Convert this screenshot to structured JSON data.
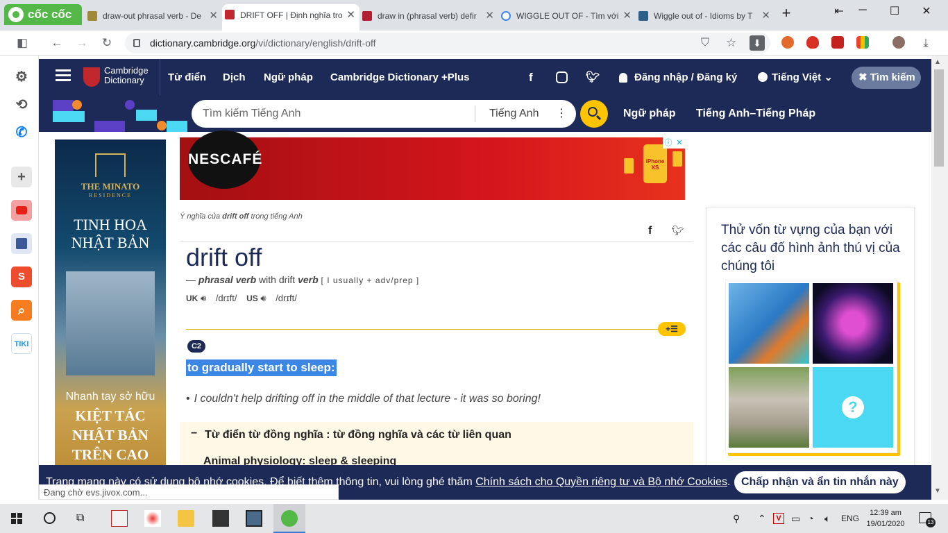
{
  "browser": {
    "brand": "cốc cốc",
    "tabs": [
      {
        "title": "draw-out phrasal verb - De",
        "active": false
      },
      {
        "title": "DRIFT OFF | Định nghĩa tro",
        "active": true
      },
      {
        "title": "draw in (phrasal verb) defir",
        "active": false
      },
      {
        "title": "WIGGLE OUT OF - Tìm với C",
        "active": false
      },
      {
        "title": "Wiggle out of - Idioms by T",
        "active": false
      }
    ],
    "url_host": "dictionary.cambridge.org",
    "url_path": "/vi/dictionary/english/drift-off"
  },
  "site": {
    "logo_line1": "Cambridge",
    "logo_line2": "Dictionary",
    "nav": [
      "Từ điển",
      "Dịch",
      "Ngữ pháp",
      "Cambridge Dictionary +Plus"
    ],
    "login": "Đăng nhập / Đăng ký",
    "language": "Tiếng Việt",
    "search_toggle": "Tìm kiếm",
    "search_placeholder": "Tìm kiếm Tiếng Anh",
    "search_lang": "Tiếng Anh",
    "nav2": [
      "Ngữ pháp",
      "Tiếng Anh–Tiếng Pháp"
    ]
  },
  "ads": {
    "left_brand": "THE MINATO",
    "left_sub": "RESIDENCE",
    "left_title1": "TINH HOA",
    "left_title2": "NHẬT BẢN",
    "left_cta1": "Nhanh tay sở hữu",
    "left_cta2": "KIỆT TÁC",
    "left_cta3": "NHẬT BẢN",
    "left_cta4": "TRÊN CAO",
    "banner_brand": "NESCAFÉ",
    "banner_badge": "iPhone XS"
  },
  "entry": {
    "caption_pre": "Ý nghĩa của ",
    "caption_word": "drift off",
    "caption_post": " trong tiếng Anh",
    "headword": "drift off",
    "pos_dash": "—",
    "pos_type": "phrasal verb",
    "pos_with": "with drift",
    "pos_verb": "verb",
    "grammar": "[ I usually + adv/prep ]",
    "uk_label": "UK",
    "uk_ipa": "/drɪft/",
    "us_label": "US",
    "us_ipa": "/drɪft/",
    "level": "C2",
    "definition": "to gradually start to sleep:",
    "example": "I couldn't help drifting off in the middle of that lecture - it was so boring!",
    "synonym_header": "Từ điển từ đồng nghĩa : từ đồng nghĩa và các từ liên quan",
    "synonym_topic": "Animal physiology: sleep & sleeping"
  },
  "quiz": {
    "title": "Thử vốn từ vựng của bạn với các câu đố hình ảnh thú vị của chúng tôi"
  },
  "cookie": {
    "text": "Trang mạng này có sử dụng bộ nhớ cookies. Để biết thêm thông tin, vui lòng ghé thăm ",
    "link": "Chính sách cho Quyền riêng tư và Bộ nhớ Cookies",
    "end": ".",
    "button": "Chấp nhận và ẩn tin nhắn này"
  },
  "status_text": "Đang chờ evs.jivox.com...",
  "taskbar": {
    "lang": "ENG",
    "time": "12:39 am",
    "date": "19/01/2020",
    "notif_count": "13"
  }
}
